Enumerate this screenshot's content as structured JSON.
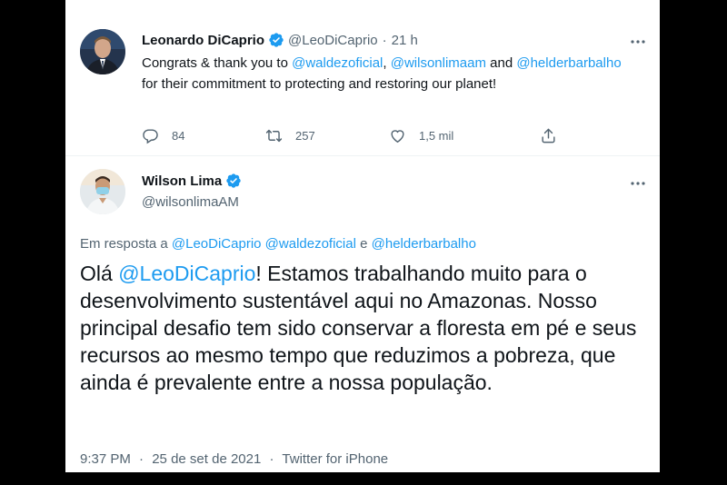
{
  "tweet1": {
    "author_name": "Leonardo DiCaprio",
    "handle": "@LeoDiCaprio",
    "separator": "·",
    "time": "21 h",
    "text_1": "Congrats & thank you to ",
    "mention_1": "@waldezoficial",
    "text_2": ", ",
    "mention_2": "@wilsonlimaam",
    "text_3": " and ",
    "mention_3": "@helderbarbalho",
    "text_4": " for their commitment to protecting and restoring our planet!",
    "reply_count": "84",
    "retweet_count": "257",
    "like_count": "1,5 mil"
  },
  "tweet2": {
    "author_name": "Wilson Lima",
    "handle": "@wilsonlimaAM",
    "reply_prefix": "Em resposta a ",
    "reply_mention_1": "@LeoDiCaprio",
    "reply_mention_2": "@waldezoficial",
    "reply_conj": " e ",
    "reply_mention_3": "@helderbarbalho",
    "text_1": "Olá ",
    "mention": "@LeoDiCaprio",
    "text_2": "! Estamos trabalhando muito para o desenvolvimento sustentável aqui no Amazonas. Nosso principal desafio tem sido conservar a floresta em pé e seus recursos ao mesmo tempo que reduzimos a pobreza, que ainda é prevalente entre a nossa população.",
    "time": "9:37 PM",
    "separator": "·",
    "date": "25 de set de 2021",
    "source": "Twitter for iPhone"
  },
  "colors": {
    "link": "#1d9bf0",
    "verified": "#1d9bf0",
    "muted": "#536471",
    "text": "#0f1419"
  },
  "icons": {
    "reply": "reply-icon",
    "retweet": "retweet-icon",
    "like": "heart-icon",
    "share": "share-icon",
    "more": "more-icon",
    "verified": "verified-badge-icon"
  }
}
